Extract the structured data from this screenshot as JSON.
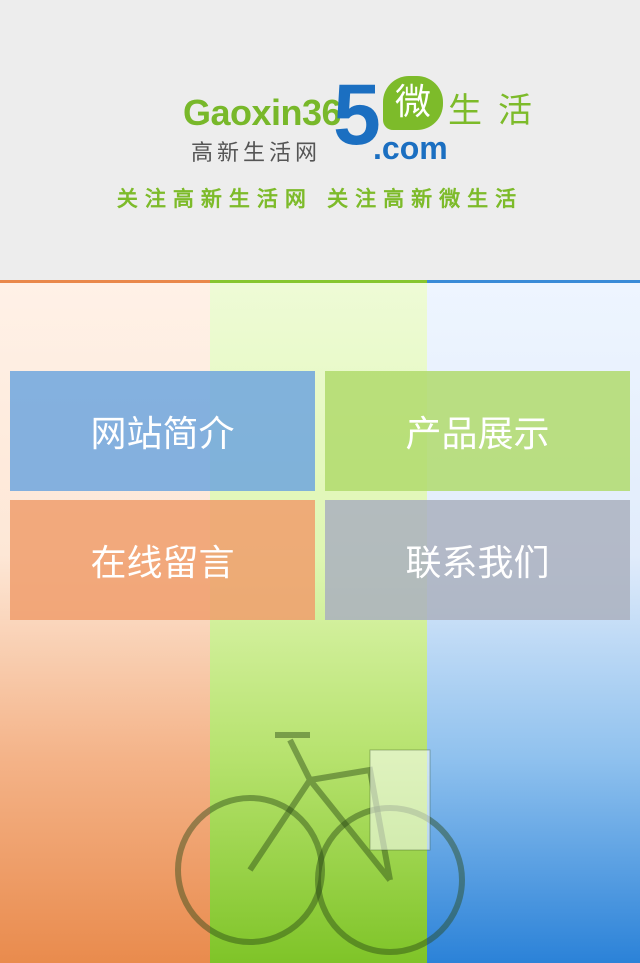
{
  "header": {
    "logo": {
      "text_en": "Gaoxin36",
      "text_five": "5",
      "text_com": ".com",
      "text_cn": "高新生活网",
      "bubble_char": "微",
      "life_text": "生活"
    },
    "slogan": "关注高新生活网  关注高新微生活"
  },
  "menu": {
    "items": [
      {
        "label": "网站简介"
      },
      {
        "label": "产品展示"
      },
      {
        "label": "在线留言"
      },
      {
        "label": "联系我们"
      }
    ]
  },
  "theme": {
    "green": "#7dbb2a",
    "blue": "#1b6fc1",
    "orange": "#e9884b"
  }
}
